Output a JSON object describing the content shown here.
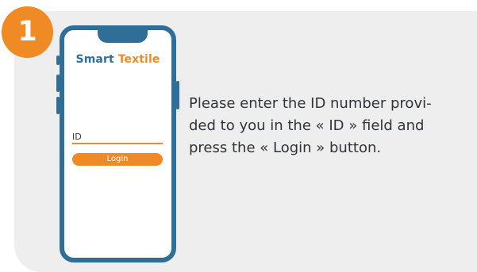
{
  "step": {
    "number": "1"
  },
  "phone": {
    "brand": {
      "part1": "Smart",
      "part2": "Textile"
    },
    "id_label": "ID",
    "login_label": "Login"
  },
  "instructions": {
    "lines": [
      "Please enter the ID number provi-",
      "ded to you in the « ID » field and",
      "press the « Login » button."
    ]
  },
  "colors": {
    "accent": "#f08a24",
    "phone_frame": "#2f6f97",
    "card_background": "#eeeeee",
    "text": "#2f3438"
  }
}
